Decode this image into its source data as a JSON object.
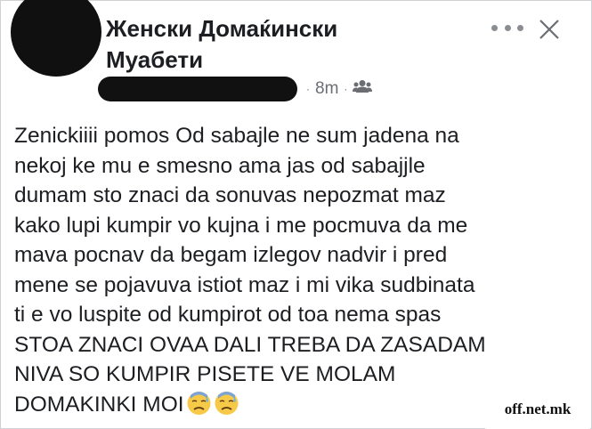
{
  "post": {
    "group_name_line1": "Женски Домаќински",
    "group_name_line2": "Муабети",
    "time_ago": "8m",
    "separator": "·",
    "audience_icon": "group-audience-icon",
    "body_lines": [
      "Zenickiiii pomos Od sabajle ne sum jadena na",
      "nekoj ke mu e smesno  ama jas od sabajjle",
      "dumam sto znaci da sonuvas nepozmat maz",
      "kako lupi kumpir vo kujna i me pocmuva da me",
      "mava pocnav da begam izlegov nadvir i pred",
      "mene se pojavuva istiot maz i mi vika sudbinata",
      "ti e vo luspite od kumpirot od toa nema spas",
      "STOA ZNACI OVAA DALI TREBA DA ZASADAM",
      "NIVA SO KUMPIR PISETE VE MOLAM",
      "DOMAKINKI MOI"
    ],
    "emojis": [
      "sweat-face-emoji",
      "sweat-face-emoji"
    ]
  },
  "header_icons": {
    "more": "more-options-icon",
    "close": "close-icon"
  },
  "watermark": "off.net.mk",
  "colors": {
    "text": "#1c1e21",
    "meta": "#6a6e73",
    "icon": "#8a8d91"
  }
}
